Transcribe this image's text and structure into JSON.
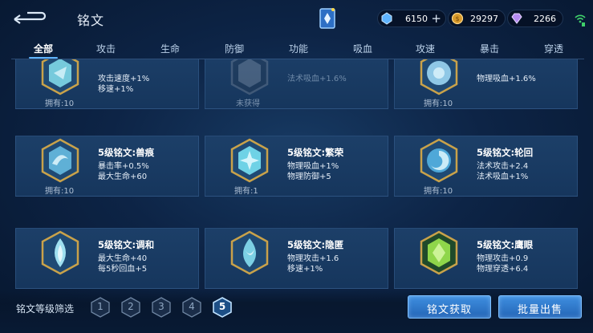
{
  "header": {
    "title": "铭文",
    "resources": [
      {
        "icon": "blue-gem-icon",
        "value": "6150"
      },
      {
        "icon": "gold-coin-icon",
        "value": "29297"
      },
      {
        "icon": "purple-diamond-icon",
        "value": "2266"
      }
    ],
    "plus": "+"
  },
  "tabs": [
    "全部",
    "攻击",
    "生命",
    "防御",
    "功能",
    "吸血",
    "攻速",
    "暴击",
    "穿透"
  ],
  "active_tab": 0,
  "cards": [
    {
      "name": "",
      "stat1": "攻击速度+1%",
      "stat2": "移速+1%",
      "owned": "拥有:10",
      "gem_color": "#7fd8e8"
    },
    {
      "name": "",
      "stat1": "法术吸血+1.6%",
      "stat2": "",
      "owned": "未获得",
      "gem_color": "#9aa6b4"
    },
    {
      "name": "",
      "stat1": "物理吸血+1.6%",
      "stat2": "",
      "owned": "拥有:10",
      "gem_color": "#8fc8e6"
    },
    {
      "name": "5级铭文:兽痕",
      "stat1": "暴击率+0.5%",
      "stat2": "最大生命+60",
      "owned": "拥有:10",
      "gem_color": "#5fb0d6"
    },
    {
      "name": "5级铭文:繁荣",
      "stat1": "物理吸血+1%",
      "stat2": "物理防御+5",
      "owned": "拥有:1",
      "gem_color": "#6fd2e6"
    },
    {
      "name": "5级铭文:轮回",
      "stat1": "法术攻击+2.4",
      "stat2": "法术吸血+1%",
      "owned": "拥有:10",
      "gem_color": "#4fa8d8"
    },
    {
      "name": "5级铭文:调和",
      "stat1": "最大生命+40",
      "stat2": "每5秒回血+5",
      "owned": "",
      "gem_color": "#9fe0f0"
    },
    {
      "name": "5级铭文:隐匿",
      "stat1": "物理攻击+1.6",
      "stat2": "移速+1%",
      "owned": "",
      "gem_color": "#7cd0e4"
    },
    {
      "name": "5级铭文:鹰眼",
      "stat1": "物理攻击+0.9",
      "stat2": "物理穿透+6.4",
      "owned": "",
      "gem_color": "#8fd64a"
    }
  ],
  "footer": {
    "filter_label": "铭文等级筛选",
    "levels": [
      "1",
      "2",
      "3",
      "4",
      "5"
    ],
    "active_level": "5",
    "btn_get": "铭文获取",
    "btn_sell": "批量出售"
  },
  "colors": {
    "accent": "#5fb4ff",
    "gold_frame": "#c9a24a"
  }
}
